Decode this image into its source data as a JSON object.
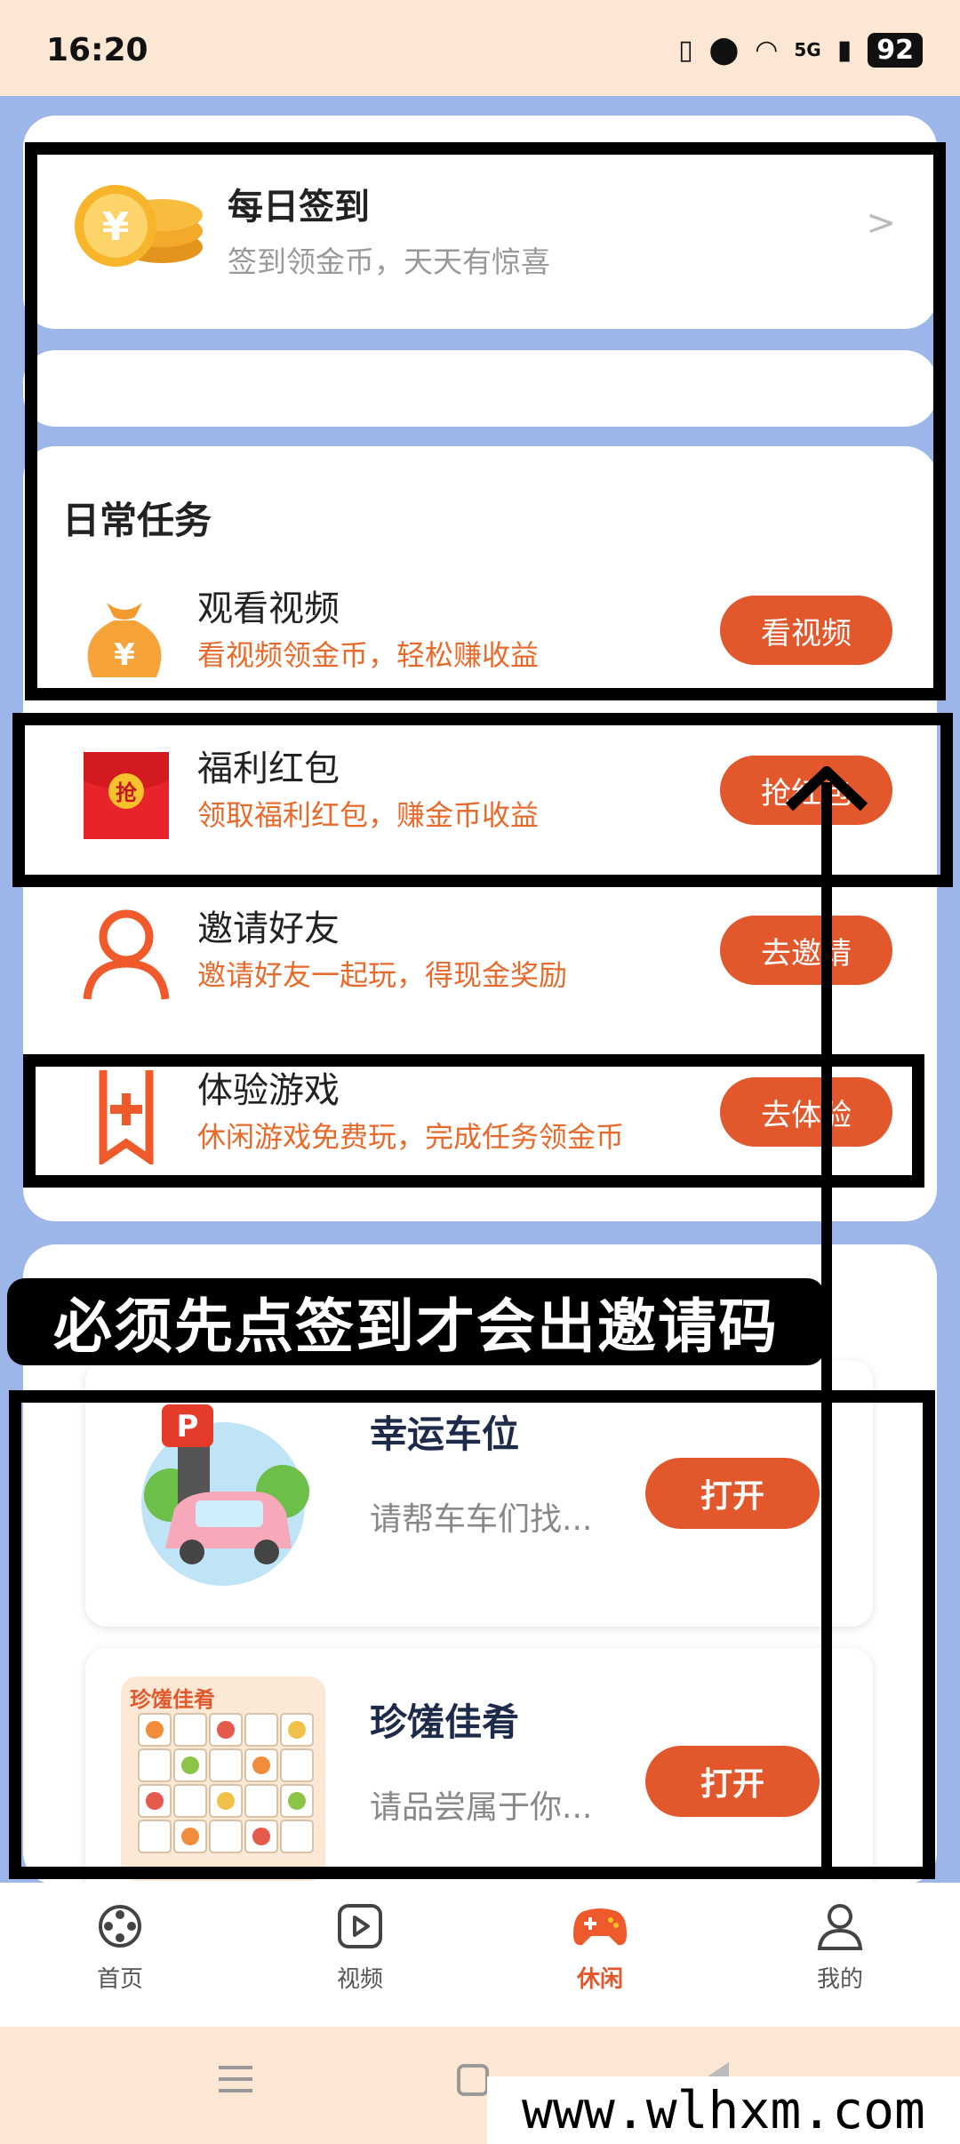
{
  "status": {
    "time": "16:20",
    "battery": "92",
    "network": "5G"
  },
  "checkin": {
    "title": "每日签到",
    "subtitle": "签到领金币，天天有惊喜",
    "arrow": ">"
  },
  "daily_tasks": {
    "section_title": "日常任务",
    "items": [
      {
        "name": "观看视频",
        "desc": "看视频领金币，轻松赚收益",
        "button": "看视频",
        "icon": "money-bag-icon"
      },
      {
        "name": "福利红包",
        "desc": "领取福利红包，赚金币收益",
        "button": "抢红包",
        "icon": "red-envelope-icon"
      },
      {
        "name": "邀请好友",
        "desc": "邀请好友一起玩，得现金奖励",
        "button": "去邀请",
        "icon": "person-icon"
      },
      {
        "name": "体验游戏",
        "desc": "休闲游戏免费玩，完成任务领金币",
        "button": "去体验",
        "icon": "bookmark-plus-icon"
      }
    ]
  },
  "games": [
    {
      "name": "幸运车位",
      "desc": "请帮车车们找...",
      "button": "打开"
    },
    {
      "name": "珍馐佳肴",
      "desc": "请品尝属于你...",
      "button": "打开",
      "thumb_title": "珍馐佳肴"
    }
  ],
  "annotation": {
    "caption": "必须先点签到才会出邀请码"
  },
  "tabs": [
    {
      "label": "首页",
      "icon": "film-reel-icon",
      "active": false
    },
    {
      "label": "视频",
      "icon": "video-play-icon",
      "active": false
    },
    {
      "label": "休闲",
      "icon": "gamepad-icon",
      "active": true
    },
    {
      "label": "我的",
      "icon": "user-icon",
      "active": false
    }
  ],
  "watermark": "www.wlhxm.com",
  "colors": {
    "accent": "#e2572c",
    "desc_orange": "#e86a2b",
    "page_bg": "#9cb6ea",
    "status_bg": "#fce6d4"
  }
}
